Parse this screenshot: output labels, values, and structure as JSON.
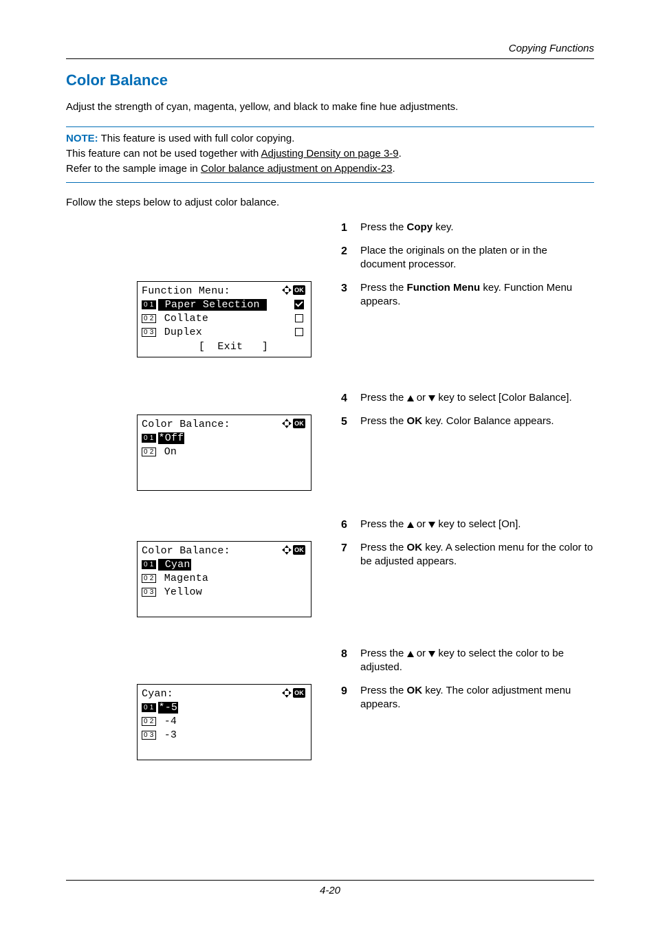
{
  "doc": {
    "header": "Copying Functions",
    "title": "Color Balance",
    "intro": "Adjust the strength of cyan, magenta, yellow, and black to make fine hue adjustments.",
    "note_label": "NOTE:",
    "note_line1_a": " This feature is used with full color copying.",
    "note_line2_a": "This feature can not be used together with ",
    "note_line2_link": "Adjusting Density on page 3-9",
    "note_line2_b": ".",
    "note_line3_a": "Refer to the sample image in ",
    "note_line3_link": "Color balance adjustment on Appendix-23",
    "note_line3_b": ".",
    "follow": "Follow the steps below to adjust color balance.",
    "page_number": "4-20"
  },
  "steps": {
    "s1_a": "Press the ",
    "s1_key": "Copy",
    "s1_b": " key.",
    "s2": "Place the originals on the platen or in the document processor.",
    "s3_a": "Press the ",
    "s3_key": "Function Menu",
    "s3_b": " key. Function Menu appears.",
    "s4_a": "Press the ",
    "s4_b": " or ",
    "s4_c": " key to select [Color Balance].",
    "s5_a": "Press the ",
    "s5_key": "OK",
    "s5_b": " key. Color Balance appears.",
    "s6_a": "Press the ",
    "s6_b": " or ",
    "s6_c": " key to select [On].",
    "s7_a": "Press the ",
    "s7_key": "OK",
    "s7_b": " key. A selection menu for the color to be adjusted appears.",
    "s8_a": "Press the ",
    "s8_b": " or ",
    "s8_c": " key to select the color to be adjusted.",
    "s9_a": "Press the ",
    "s9_key": "OK",
    "s9_b": " key. The color adjustment menu appears."
  },
  "lcd1": {
    "title": "Function Menu:",
    "n1": "0 1",
    "r1": " Paper Selection ",
    "n2": "0 2",
    "r2": " Collate",
    "n3": "0 3",
    "r3": " Duplex",
    "r4": "         [  Exit   ]"
  },
  "lcd2": {
    "title": "Color Balance:",
    "n1": "0 1",
    "r1": "*Off",
    "n2": "0 2",
    "r2": " On"
  },
  "lcd3": {
    "title": "Color Balance:",
    "n1": "0 1",
    "r1": " Cyan",
    "n2": "0 2",
    "r2": " Magenta",
    "n3": "0 3",
    "r3": " Yellow"
  },
  "lcd4": {
    "title": "Cyan:",
    "n1": "0 1",
    "r1": "*-5",
    "n2": "0 2",
    "r2": " -4",
    "n3": "0 3",
    "r3": " -3"
  }
}
